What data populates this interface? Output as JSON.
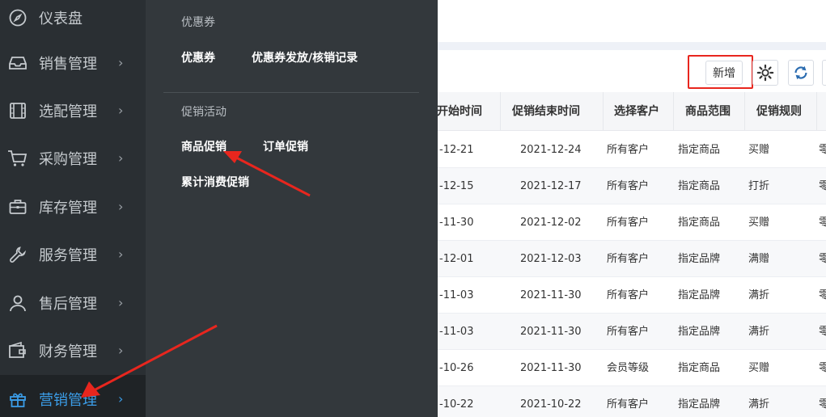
{
  "toolbar": {
    "add_label": "新增",
    "settings_icon": "gear-icon",
    "refresh_icon": "refresh-icon"
  },
  "sidebar": {
    "items": [
      {
        "label": "仪表盘",
        "icon": "compass-icon",
        "has_children": false
      },
      {
        "label": "销售管理",
        "icon": "inbox-icon",
        "has_children": true
      },
      {
        "label": "选配管理",
        "icon": "film-icon",
        "has_children": true
      },
      {
        "label": "采购管理",
        "icon": "cart-icon",
        "has_children": true
      },
      {
        "label": "库存管理",
        "icon": "briefcase-icon",
        "has_children": true
      },
      {
        "label": "服务管理",
        "icon": "wrench-icon",
        "has_children": true
      },
      {
        "label": "售后管理",
        "icon": "user-icon",
        "has_children": true
      },
      {
        "label": "财务管理",
        "icon": "wallet-icon",
        "has_children": true
      },
      {
        "label": "营销管理",
        "icon": "gift-icon",
        "has_children": true,
        "active": true
      }
    ],
    "chevron": "›"
  },
  "flyout": {
    "groups": [
      {
        "title": "优惠券",
        "links": [
          "优惠券",
          "优惠券发放/核销记录"
        ]
      },
      {
        "title": "促销活动",
        "links": [
          "商品促销",
          "订单促销",
          "累计消费促销"
        ]
      }
    ]
  },
  "table": {
    "columns": [
      "开始时间",
      "促销结束时间",
      "选择客户",
      "商品范围",
      "促销规则"
    ],
    "rows": [
      [
        "-12-21",
        "2021-12-24",
        "所有客户",
        "指定商品",
        "买赠",
        "零"
      ],
      [
        "-12-15",
        "2021-12-17",
        "所有客户",
        "指定商品",
        "打折",
        "零"
      ],
      [
        "-11-30",
        "2021-12-02",
        "所有客户",
        "指定商品",
        "买赠",
        "零"
      ],
      [
        "-12-01",
        "2021-12-03",
        "所有客户",
        "指定品牌",
        "满赠",
        "零"
      ],
      [
        "-11-03",
        "2021-11-30",
        "所有客户",
        "指定品牌",
        "满折",
        "零"
      ],
      [
        "-11-03",
        "2021-11-30",
        "所有客户",
        "指定品牌",
        "满折",
        "零"
      ],
      [
        "-10-26",
        "2021-11-30",
        "会员等级",
        "指定商品",
        "买赠",
        "零"
      ],
      [
        "-10-22",
        "2021-10-22",
        "所有客户",
        "指定品牌",
        "满折",
        "零"
      ]
    ]
  },
  "colors": {
    "sidebar_bg": "#2a2f33",
    "flyout_bg": "#33383c",
    "active": "#3b9de8",
    "highlight": "#e8261e"
  }
}
